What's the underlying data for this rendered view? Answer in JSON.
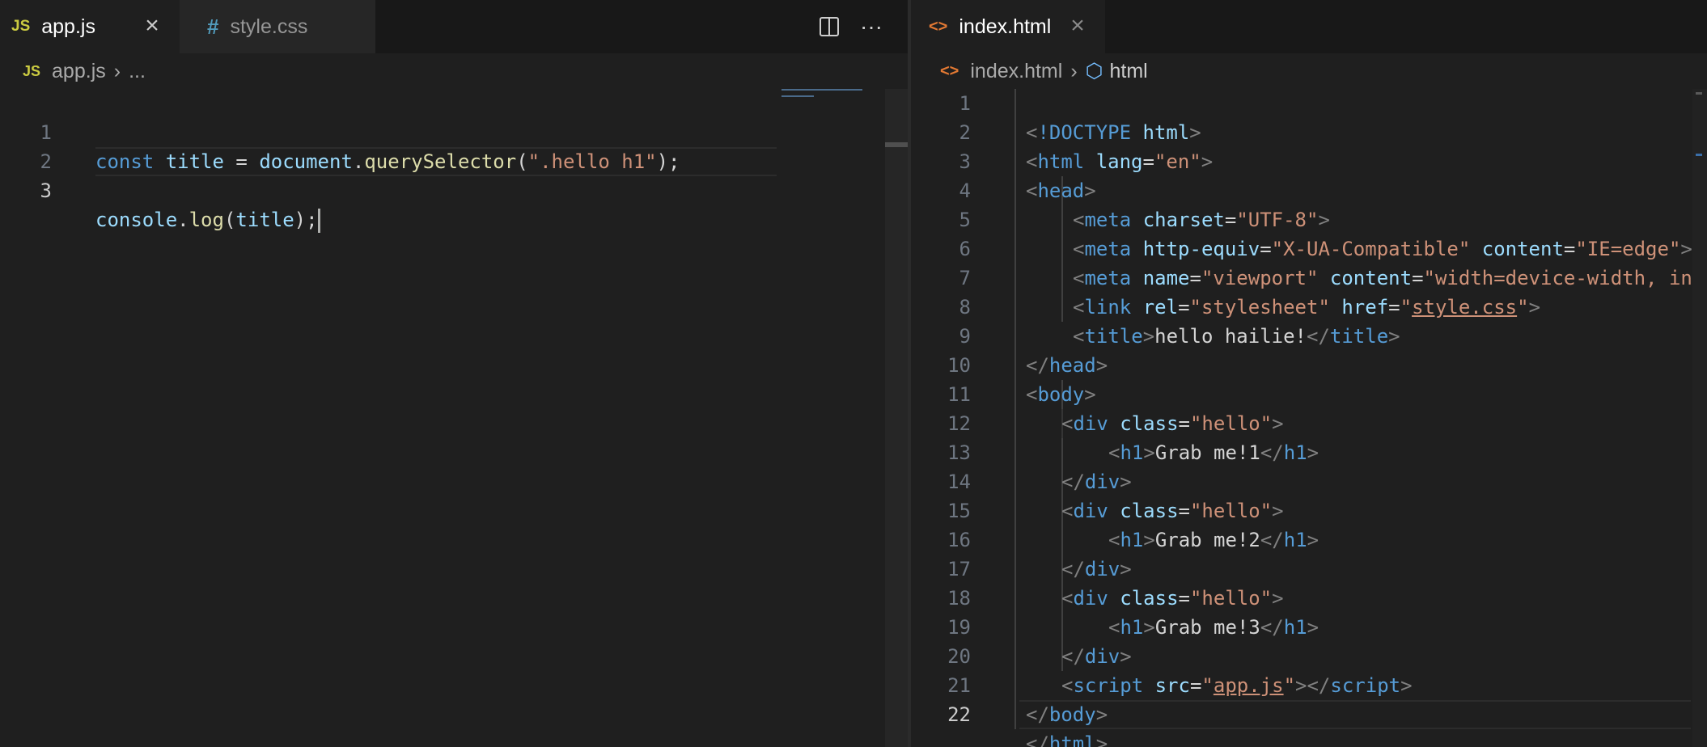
{
  "left": {
    "tabs": [
      {
        "icon": "JS",
        "label": "app.js",
        "close": "×"
      },
      {
        "icon": "#",
        "label": "style.css"
      }
    ],
    "actions": {
      "split": "⊟",
      "more": "···"
    },
    "breadcrumb": {
      "icon": "JS",
      "file": "app.js",
      "sep": "›",
      "more": "..."
    },
    "lines": [
      {
        "n": "1"
      },
      {
        "n": "2"
      },
      {
        "n": "3"
      }
    ],
    "code": {
      "l1": {
        "kw": "const",
        "name": "title",
        "eq": " = ",
        "obj": "document",
        "dot": ".",
        "fn": "querySelector",
        "open": "(",
        "str": "\".hello h1\"",
        "close": ");"
      },
      "l3": {
        "obj": "console",
        "dot": ".",
        "fn": "log",
        "open": "(",
        "arg": "title",
        "close": ");"
      }
    }
  },
  "right": {
    "tab": {
      "icon": "<>",
      "label": "index.html",
      "close": "×"
    },
    "breadcrumb": {
      "icon": "<>",
      "file": "index.html",
      "sep": "›",
      "node_icon": "⬡",
      "node": "html"
    },
    "lines": [
      "1",
      "2",
      "3",
      "4",
      "5",
      "6",
      "7",
      "8",
      "9",
      "10",
      "11",
      "12",
      "13",
      "14",
      "15",
      "16",
      "17",
      "18",
      "19",
      "20",
      "21",
      "22"
    ],
    "code": {
      "doctype": "!DOCTYPE",
      "html": "html",
      "lang": "lang",
      "en": "\"en\"",
      "head": "head",
      "meta": "meta",
      "charset": "charset",
      "utf8": "\"UTF-8\"",
      "httpequiv": "http-equiv",
      "xua": "\"X-UA-Compatible\"",
      "content": "content",
      "ieedge": "\"IE=edge\"",
      "name": "name",
      "viewport": "\"viewport\"",
      "vpcontent": "\"width=device-width, in",
      "link": "link",
      "rel": "rel",
      "stylesheet": "\"stylesheet\"",
      "href": "href",
      "q": "\"",
      "stylecss": "style.css",
      "title": "title",
      "titletext": "hello hailie!",
      "body": "body",
      "div": "div",
      "class": "class",
      "hello": "\"hello\"",
      "h1": "h1",
      "g1": "Grab me!1",
      "g2": "Grab me!2",
      "g3": "Grab me!3",
      "script": "script",
      "src": "src",
      "appjs": "app.js",
      "lt": "<",
      "gt": ">",
      "ltslash": "</",
      "eq": "="
    }
  },
  "colors": {
    "editor_bg": "#1f1f1f",
    "tab_inactive": "#262626",
    "js_yellow": "#cbcb41",
    "css_blue": "#519aba",
    "html_orange": "#e37933"
  }
}
